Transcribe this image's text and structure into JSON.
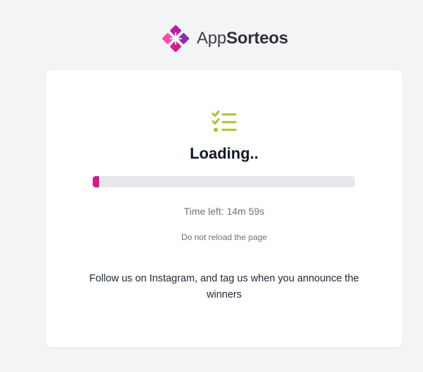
{
  "header": {
    "brand_light": "App",
    "brand_bold": "Sorteos",
    "logo_icon": "appsorteos-logo-icon"
  },
  "loader": {
    "icon": "checklist-icon",
    "title": "Loading..",
    "progress_percent": 2.5,
    "time_left": "Time left: 14m 59s",
    "warning": "Do not reload the page",
    "follow_text": "Follow us on Instagram, and tag us when you announce the winners"
  },
  "colors": {
    "background": "#f3f4f6",
    "card": "#ffffff",
    "accent_magenta": "#d61a8b",
    "icon_green": "#a3c52a",
    "track": "#e5e7eb"
  }
}
